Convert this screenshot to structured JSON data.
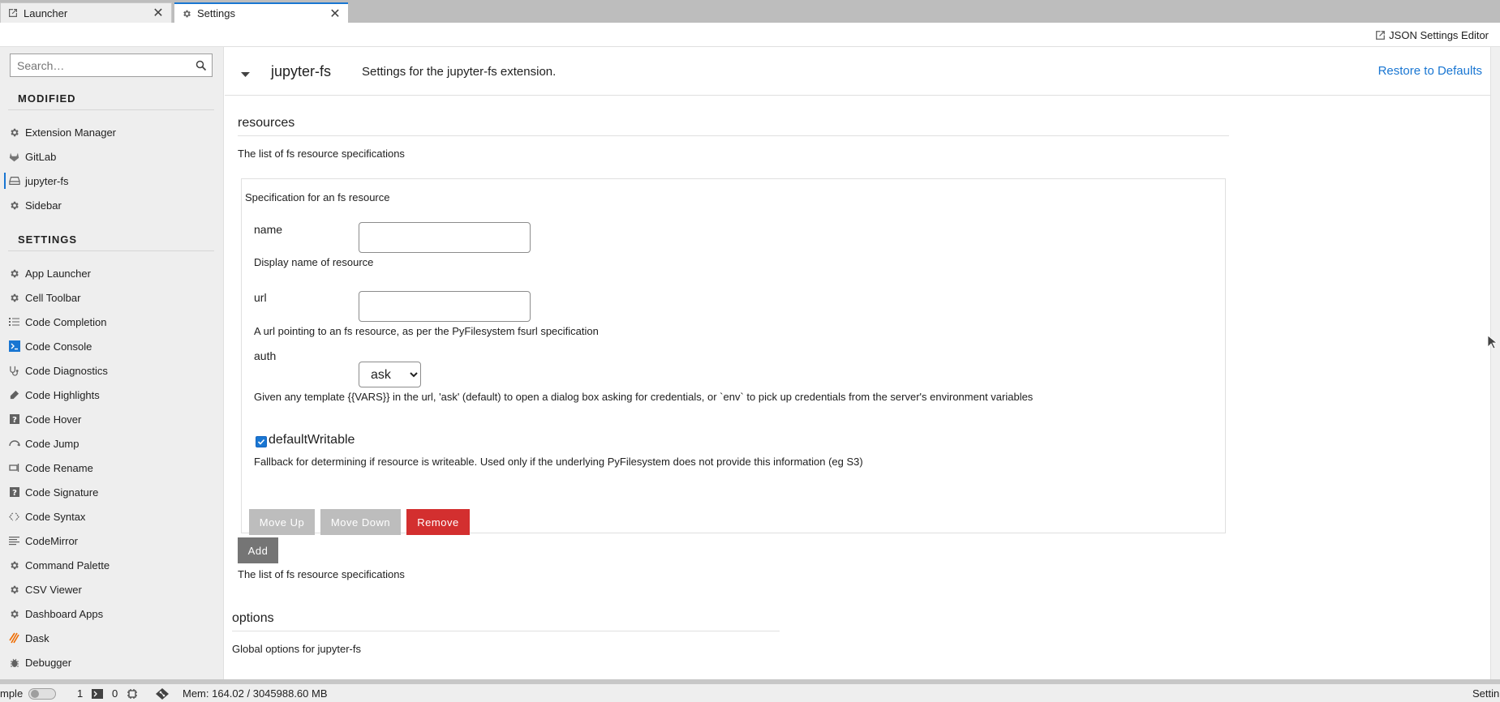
{
  "tabs": [
    {
      "label": "Launcher",
      "icon": "launcher-icon"
    },
    {
      "label": "Settings",
      "icon": "gear-icon"
    }
  ],
  "toolbar": {
    "json_editor_label": "JSON Settings Editor"
  },
  "sidebar": {
    "search_placeholder": "Search…",
    "modified_heading": "MODIFIED",
    "modified_items": [
      {
        "label": "Extension Manager",
        "icon": "gear-icon"
      },
      {
        "label": "GitLab",
        "icon": "gitlab-icon"
      },
      {
        "label": "jupyter-fs",
        "icon": "drive-icon",
        "active": true
      },
      {
        "label": "Sidebar",
        "icon": "gear-icon"
      }
    ],
    "settings_heading": "SETTINGS",
    "settings_items": [
      {
        "label": "App Launcher",
        "icon": "gear-icon"
      },
      {
        "label": "Cell Toolbar",
        "icon": "gear-icon"
      },
      {
        "label": "Code Completion",
        "icon": "list-icon"
      },
      {
        "label": "Code Console",
        "icon": "console-icon"
      },
      {
        "label": "Code Diagnostics",
        "icon": "stethoscope-icon"
      },
      {
        "label": "Code Highlights",
        "icon": "highlighter-icon"
      },
      {
        "label": "Code Hover",
        "icon": "question-icon"
      },
      {
        "label": "Code Jump",
        "icon": "jump-icon"
      },
      {
        "label": "Code Rename",
        "icon": "rename-icon"
      },
      {
        "label": "Code Signature",
        "icon": "question-icon"
      },
      {
        "label": "Code Syntax",
        "icon": "syntax-icon"
      },
      {
        "label": "CodeMirror",
        "icon": "text-lines-icon"
      },
      {
        "label": "Command Palette",
        "icon": "gear-icon"
      },
      {
        "label": "CSV Viewer",
        "icon": "gear-icon"
      },
      {
        "label": "Dashboard Apps",
        "icon": "gear-icon"
      },
      {
        "label": "Dask",
        "icon": "dask-icon"
      },
      {
        "label": "Debugger",
        "icon": "bug-icon"
      }
    ]
  },
  "plugin": {
    "name": "jupyter-fs",
    "description": "Settings for the jupyter-fs extension.",
    "restore_label": "Restore to Defaults"
  },
  "resources": {
    "title": "resources",
    "description": "The list of fs resource specifications",
    "item_description": "Specification for an fs resource",
    "name_label": "name",
    "name_value": "",
    "name_description": "Display name of resource",
    "url_label": "url",
    "url_value": "",
    "url_description": "A url pointing to an fs resource, as per the PyFilesystem fsurl specification",
    "auth_label": "auth",
    "auth_value": "ask",
    "auth_description": "Given any template {{VARS}} in the url, 'ask' (default) to open a dialog box asking for credentials, or `env` to pick up credentials from the server's environment variables",
    "default_writable_label": "defaultWritable",
    "default_writable_checked": true,
    "default_writable_description": "Fallback for determining if resource is writeable. Used only if the underlying PyFilesystem does not provide this information (eg S3)",
    "move_up_label": "Move Up",
    "move_down_label": "Move Down",
    "remove_label": "Remove",
    "add_label": "Add",
    "footer_description": "The list of fs resource specifications"
  },
  "options": {
    "title": "options",
    "description": "Global options for jupyter-fs"
  },
  "statusbar": {
    "mode_label": "mple",
    "terminals_count": "1",
    "kernels_count": "0",
    "memory": "Mem: 164.02 / 3045988.60 MB",
    "right_label": "Settin"
  },
  "colors": {
    "accent": "#1976d2",
    "remove": "#d32f2f",
    "disabled": "#bdbdbd",
    "add": "#757575"
  }
}
